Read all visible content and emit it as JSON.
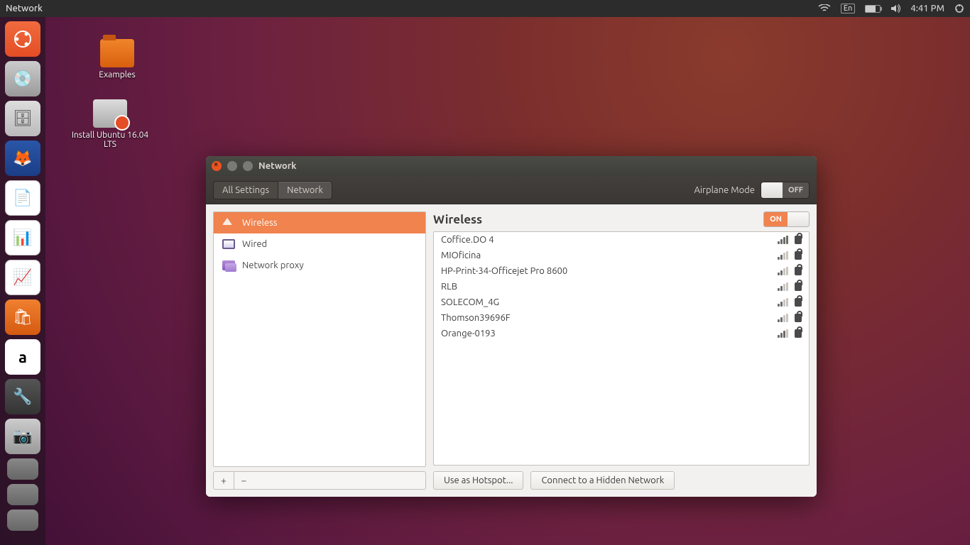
{
  "topbar": {
    "active_app": "Network",
    "language": "En",
    "time": "4:41 PM"
  },
  "desktop": {
    "examples_label": "Examples",
    "install_label": "Install Ubuntu 16.04 LTS"
  },
  "launcher_icons": [
    "ubuntu",
    "disks",
    "files",
    "firefox",
    "writer",
    "calc",
    "impress",
    "soft",
    "amazon",
    "settings",
    "disks"
  ],
  "window": {
    "title": "Network",
    "breadcrumb": {
      "all_settings": "All Settings",
      "network": "Network"
    },
    "airplane": {
      "label": "Airplane Mode",
      "state": "OFF"
    },
    "left_items": [
      {
        "key": "wireless",
        "label": "Wireless",
        "icon": "wifi",
        "selected": true
      },
      {
        "key": "wired",
        "label": "Wired",
        "icon": "wired",
        "selected": false
      },
      {
        "key": "proxy",
        "label": "Network proxy",
        "icon": "proxy",
        "selected": false
      }
    ],
    "right": {
      "heading": "Wireless",
      "toggle_state": "ON",
      "networks": [
        {
          "name": "Coffice.DO 4",
          "signal": 4,
          "secure": true
        },
        {
          "name": "MIOficina",
          "signal": 2,
          "secure": true
        },
        {
          "name": "HP-Print-34-Officejet Pro 8600",
          "signal": 2,
          "secure": true
        },
        {
          "name": "RLB",
          "signal": 2,
          "secure": true
        },
        {
          "name": "SOLECOM_4G",
          "signal": 2,
          "secure": true
        },
        {
          "name": "Thomson39696F",
          "signal": 2,
          "secure": true
        },
        {
          "name": "Orange-0193",
          "signal": 3,
          "secure": true
        }
      ],
      "hotspot_btn": "Use as Hotspot...",
      "hidden_btn": "Connect to a Hidden Network"
    }
  }
}
